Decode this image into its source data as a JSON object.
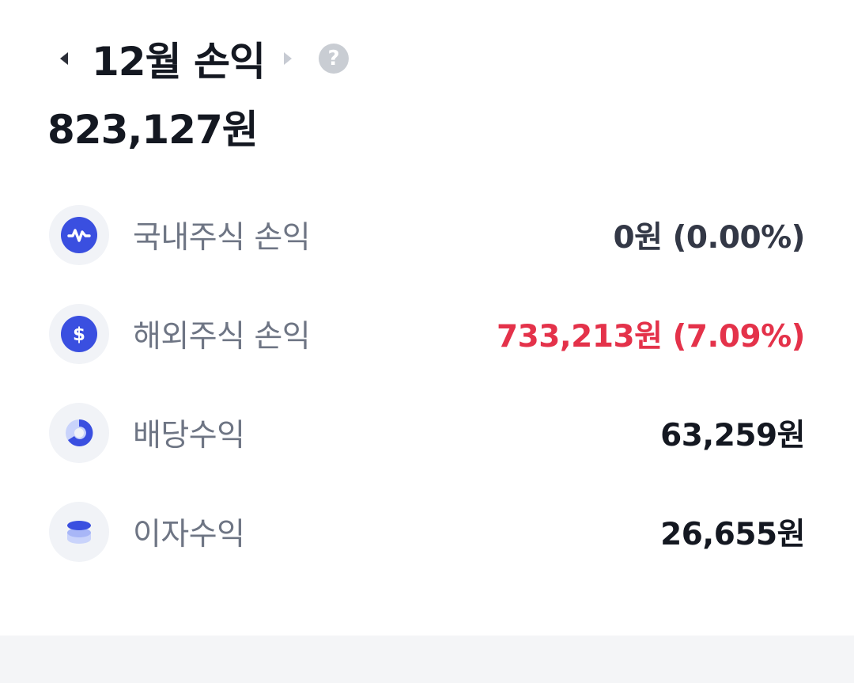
{
  "header": {
    "title": "12월 손익",
    "prev_icon": "caret-left-icon",
    "next_icon": "caret-right-icon",
    "help_icon": "question-circle-icon",
    "help_glyph": "?"
  },
  "summary": {
    "total": "823,127원"
  },
  "rows": [
    {
      "label": "국내주식 손익",
      "value": "0원 (0.00%)",
      "icon": "won-pulse-icon",
      "tone": "neutral"
    },
    {
      "label": "해외주식 손익",
      "value": "733,213원 (7.09%)",
      "icon": "dollar-icon",
      "tone": "positive"
    },
    {
      "label": "배당수익",
      "value": "63,259원",
      "icon": "pie-chart-icon",
      "tone": "default"
    },
    {
      "label": "이자수익",
      "value": "26,655원",
      "icon": "coin-stack-icon",
      "tone": "default"
    }
  ],
  "colors": {
    "accent_blue": "#3a4fe0",
    "positive_red": "#e4324a",
    "label_gray": "#6e7584",
    "icon_bg": "#f1f3f7"
  }
}
